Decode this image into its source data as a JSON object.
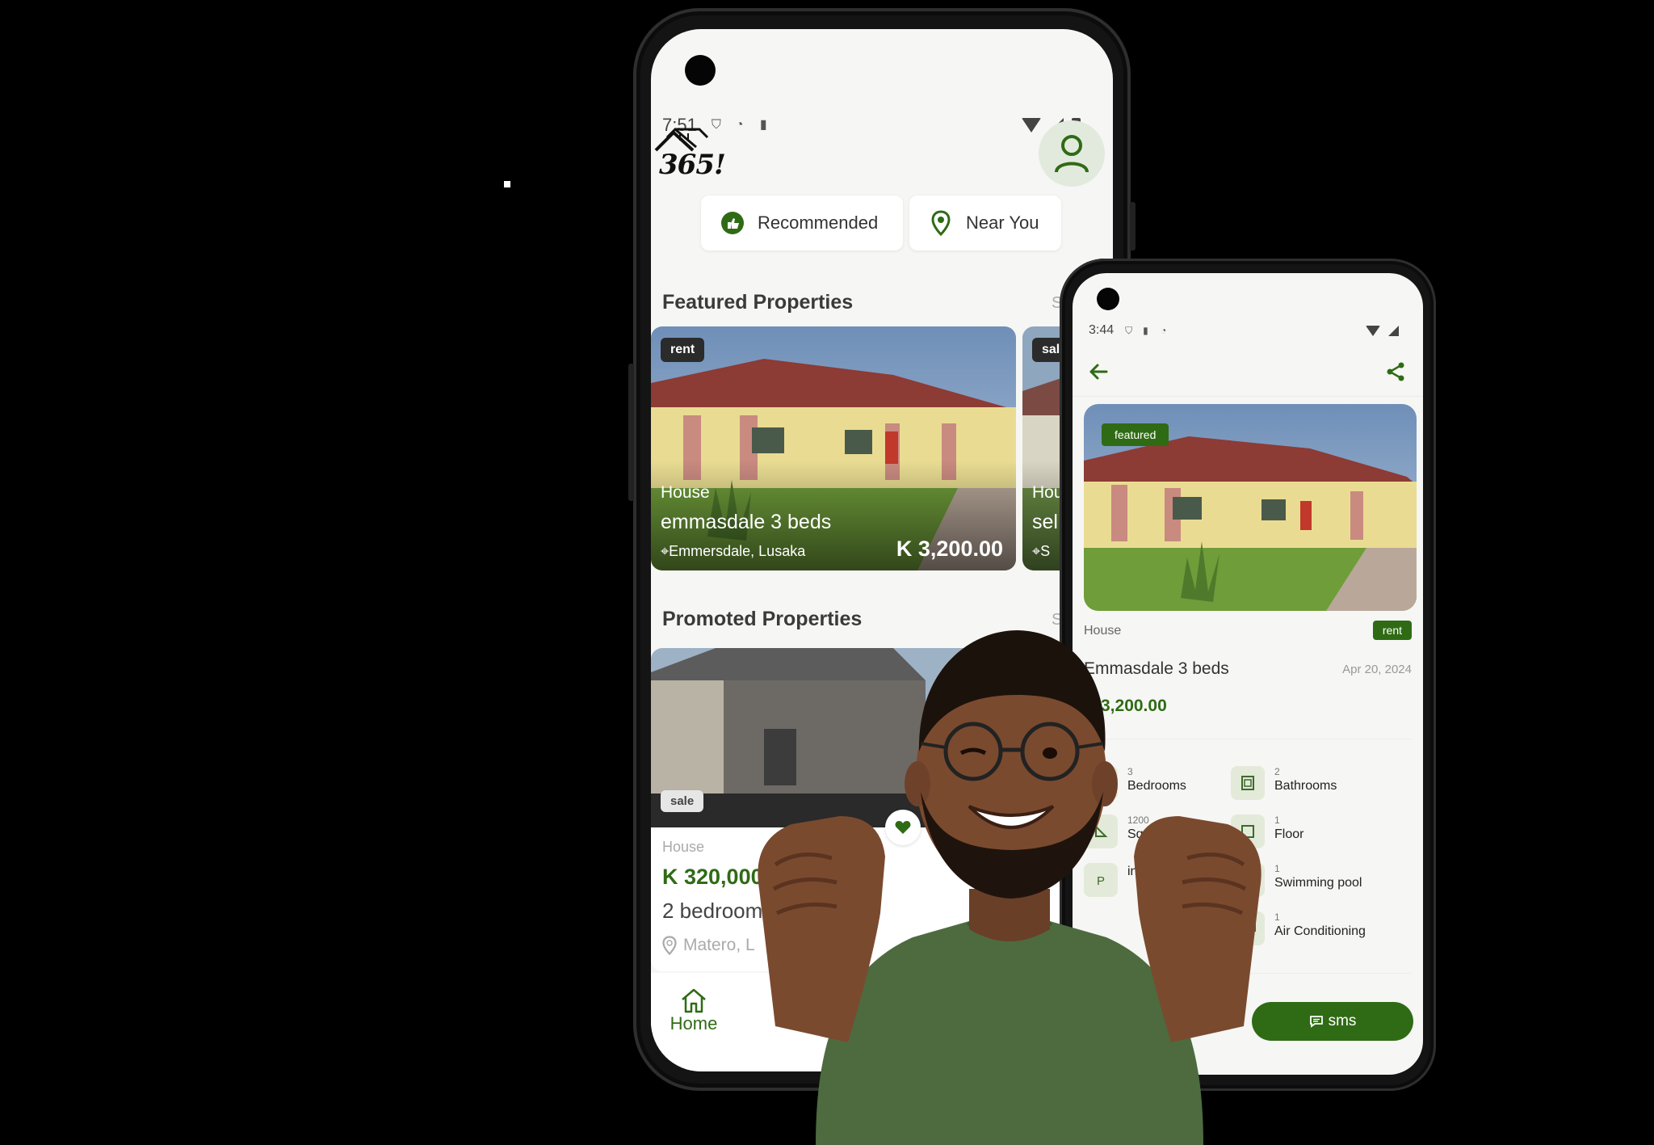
{
  "main_phone": {
    "status_bar": {
      "time": "7:51"
    },
    "logo_text": "365!",
    "tabs": [
      {
        "label": "Recommended",
        "icon": "thumbs-up-icon"
      },
      {
        "label": "Near You",
        "icon": "location-pin-icon"
      }
    ],
    "featured": {
      "title": "Featured Properties",
      "see_all": "S",
      "cards": [
        {
          "badge": "rent",
          "type": "House",
          "title": "emmasdale 3 beds",
          "location": "Emmersdale, Lusaka",
          "price": "K 3,200.00"
        },
        {
          "badge": "sal",
          "type": "Hou",
          "title": "sel",
          "location": "S"
        }
      ]
    },
    "promoted": {
      "title": "Promoted Properties",
      "see_all": "S",
      "card": {
        "badge": "sale",
        "type": "House",
        "price": "K 320,000",
        "title": "2 bedrooms",
        "location": "Matero, L"
      }
    },
    "bottom_nav": {
      "home_label": "Home"
    }
  },
  "detail_phone": {
    "status_bar": {
      "time": "3:44"
    },
    "badge": "featured",
    "type": "House",
    "listing": "rent",
    "title": "Emmasdale 3 beds",
    "date": "Apr 20, 2024",
    "price": "K 3,200.00",
    "features": [
      {
        "value": "3",
        "label": "Bedrooms",
        "icon": "bed-icon"
      },
      {
        "value": "2",
        "label": "Bathrooms",
        "icon": "bathroom-icon"
      },
      {
        "value": "1200",
        "label": "Square",
        "icon": "ruler-icon"
      },
      {
        "value": "1",
        "label": "Floor",
        "icon": "floor-icon"
      },
      {
        "value": "",
        "label": "ing",
        "icon": "parking-icon"
      },
      {
        "value": "1",
        "label": "Swimming pool",
        "icon": "pool-icon"
      },
      {
        "value": "1",
        "label": "Air Conditioning",
        "icon": "ac-icon"
      }
    ],
    "sms_label": "sms"
  },
  "colors": {
    "brand_green": "#2f6b15",
    "background": "#000000",
    "screen_bg": "#f6f6f4"
  }
}
